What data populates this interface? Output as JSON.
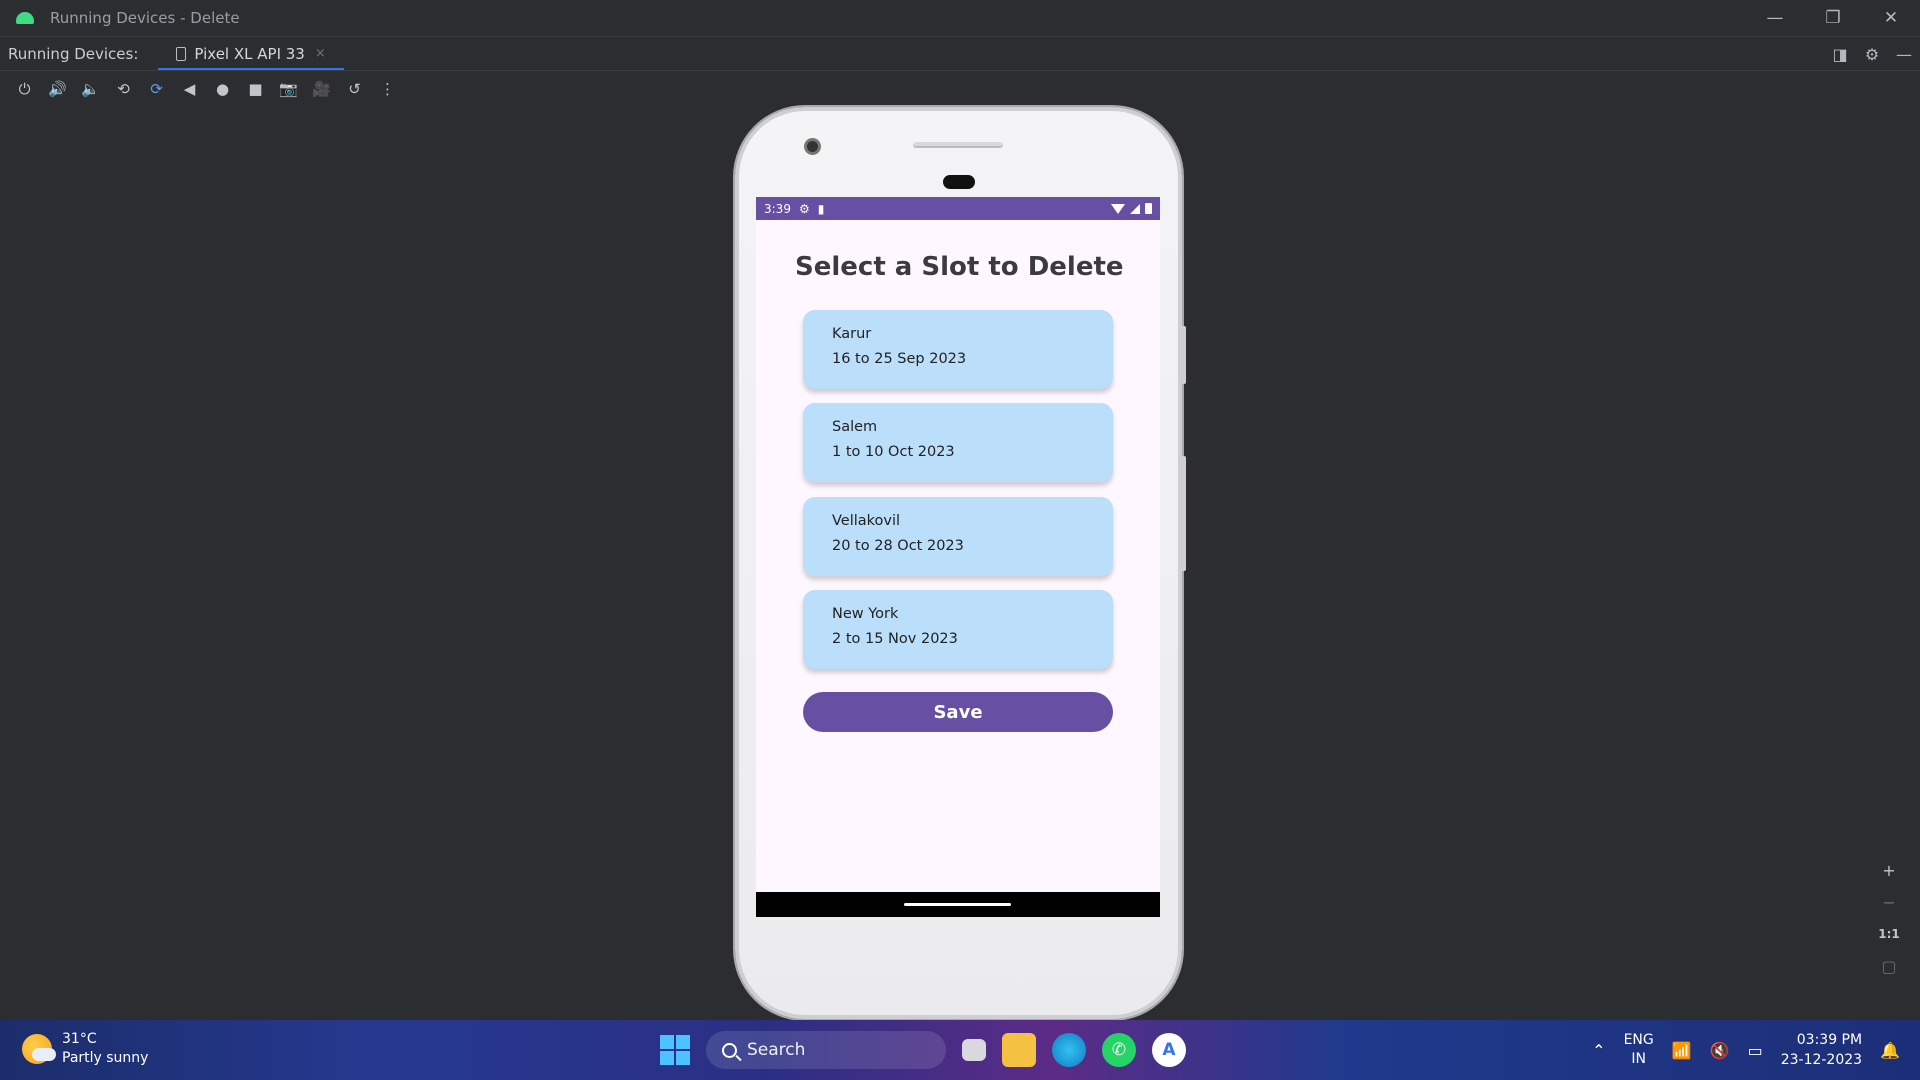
{
  "window": {
    "title": "Running Devices - Delete",
    "minimize_glyph": "—",
    "restore_glyph": "❐",
    "close_glyph": "✕"
  },
  "tabbar": {
    "label": "Running Devices:",
    "tab_label": "Pixel XL API 33",
    "tab_close": "×"
  },
  "toolbar": {
    "icons": [
      "power-icon",
      "volume-up-icon",
      "volume-down-icon",
      "rotate-left-icon",
      "rotate-right-icon",
      "back-icon",
      "home-icon",
      "overview-icon",
      "screenshot-icon",
      "screen-record-icon",
      "reset-icon",
      "more-icon"
    ]
  },
  "device": {
    "status": {
      "time": "3:39"
    },
    "screen": {
      "title": "Select a Slot to Delete",
      "slots": [
        {
          "city": "Karur",
          "dates": "16 to 25 Sep 2023"
        },
        {
          "city": "Salem",
          "dates": "1 to 10 Oct 2023"
        },
        {
          "city": "Vellakovil",
          "dates": "20 to 28 Oct 2023"
        },
        {
          "city": "New York",
          "dates": "2 to 15 Nov 2023"
        }
      ],
      "save_label": "Save"
    }
  },
  "zoom": {
    "zoom_in": "+",
    "zoom_out": "−",
    "actual_size": "1:1"
  },
  "taskbar": {
    "weather_temp": "31°C",
    "weather_desc": "Partly sunny",
    "search_label": "Search",
    "lang_top": "ENG",
    "lang_bottom": "IN",
    "time": "03:39 PM",
    "date": "23-12-2023"
  },
  "colors": {
    "ide_bg": "#2b2d30",
    "accent_blue": "#3574f0",
    "app_primary": "#6750a4",
    "card_bg": "#bbdefb"
  }
}
